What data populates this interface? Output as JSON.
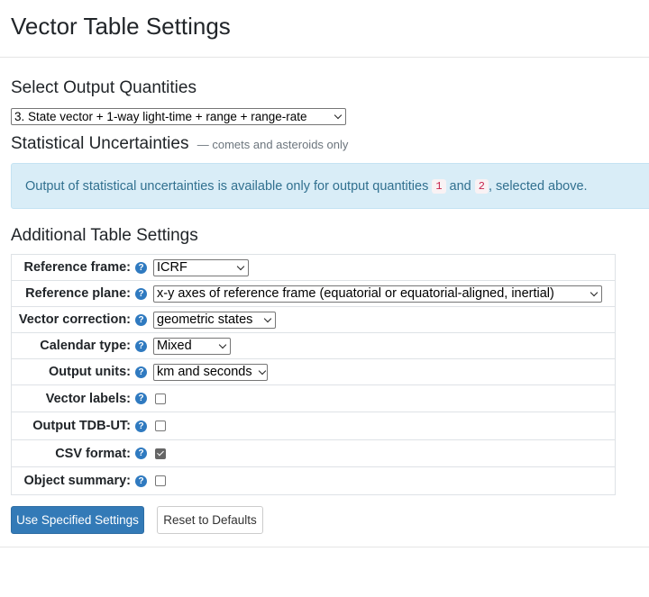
{
  "page": {
    "title": "Vector Table Settings"
  },
  "output_quantities": {
    "heading": "Select Output Quantities",
    "selected": "3. State vector + 1-way light-time + range + range-rate"
  },
  "uncertainties": {
    "heading": "Statistical Uncertainties",
    "note": "— comets and asteroids only",
    "info_prefix": "Output of statistical uncertainties is available only for output quantities",
    "code_1": "1",
    "info_and": "and",
    "code_2": "2",
    "info_suffix": ", selected above."
  },
  "additional": {
    "heading": "Additional Table Settings",
    "rows": [
      {
        "label": "Reference frame:",
        "type": "select",
        "value": "ICRF"
      },
      {
        "label": "Reference plane:",
        "type": "select",
        "value": "x-y axes of reference frame (equatorial or equatorial-aligned, inertial)"
      },
      {
        "label": "Vector correction:",
        "type": "select",
        "value": "geometric states"
      },
      {
        "label": "Calendar type:",
        "type": "select",
        "value": "Mixed"
      },
      {
        "label": "Output units:",
        "type": "select",
        "value": "km and seconds"
      },
      {
        "label": "Vector labels:",
        "type": "checkbox",
        "checked": false
      },
      {
        "label": "Output TDB-UT:",
        "type": "checkbox",
        "checked": false
      },
      {
        "label": "CSV format:",
        "type": "checkbox",
        "checked": true
      },
      {
        "label": "Object summary:",
        "type": "checkbox",
        "checked": false
      }
    ],
    "help_glyph": "?"
  },
  "buttons": {
    "use": "Use Specified Settings",
    "reset": "Reset to Defaults"
  },
  "colors": {
    "primary": "#337ab7",
    "info_bg": "#d9edf7",
    "info_text": "#31708f",
    "help_icon": "#2f7ac0"
  }
}
